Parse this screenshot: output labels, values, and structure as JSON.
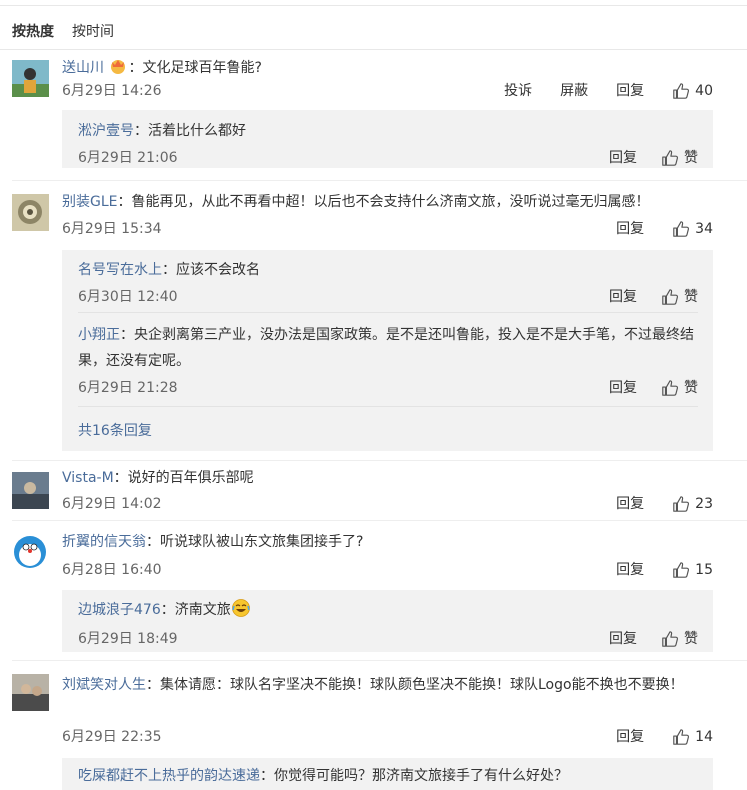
{
  "sort": {
    "hot": "按热度",
    "time": "按时间"
  },
  "comments": [
    {
      "user": "送山川",
      "text": "：文化足球百年鲁能?",
      "time": "6月29日 14:26",
      "report": "投诉",
      "block": "屏蔽",
      "reply": "回复",
      "likes": "40",
      "replies": [
        {
          "user": "淞沪壹号",
          "text": "：活着比什么都好",
          "time": "6月29日 21:06",
          "reply": "回复",
          "like": "赞"
        }
      ]
    },
    {
      "user": "别装GLE",
      "text": "：鲁能再见，从此不再看中超！以后也不会支持什么济南文旅，没听说过毫无归属感！",
      "time": "6月29日 15:34",
      "reply": "回复",
      "likes": "34",
      "replies": [
        {
          "user": "名号写在水上",
          "text": "：应该不会改名",
          "time": "6月30日 12:40",
          "reply": "回复",
          "like": "赞"
        },
        {
          "user": "小翔正",
          "text": "：央企剥离第三产业，没办法是国家政策。是不是还叫鲁能，投入是不是大手笔，不过最终结果，还没有定呢。",
          "time": "6月29日 21:28",
          "reply": "回复",
          "like": "赞"
        }
      ],
      "more": "共16条回复"
    },
    {
      "user": "Vista-M",
      "text": "：说好的百年俱乐部呢",
      "time": "6月29日 14:02",
      "reply": "回复",
      "likes": "23"
    },
    {
      "user": "折翼的信天翁",
      "text": "：听说球队被山东文旅集团接手了?",
      "time": "6月28日 16:40",
      "reply": "回复",
      "likes": "15",
      "replies": [
        {
          "user": "边城浪子476",
          "text": "：济南文旅",
          "time": "6月29日 18:49",
          "reply": "回复",
          "like": "赞"
        }
      ]
    },
    {
      "user": "刘斌笑对人生",
      "text": "：集体请愿：球队名字坚决不能换！球队颜色坚决不能换！球队Logo能不换也不要换！",
      "time": "6月29日 22:35",
      "reply": "回复",
      "likes": "14",
      "replies": [
        {
          "user": "吃屎都赶不上热乎的韵达速递",
          "text": "：你觉得可能吗？那济南文旅接手了有什么好处？"
        }
      ]
    }
  ],
  "colors": {
    "username": "#4a6c9a",
    "reply_bg": "#f2f2f2",
    "text": "#333333",
    "meta": "#666666"
  }
}
